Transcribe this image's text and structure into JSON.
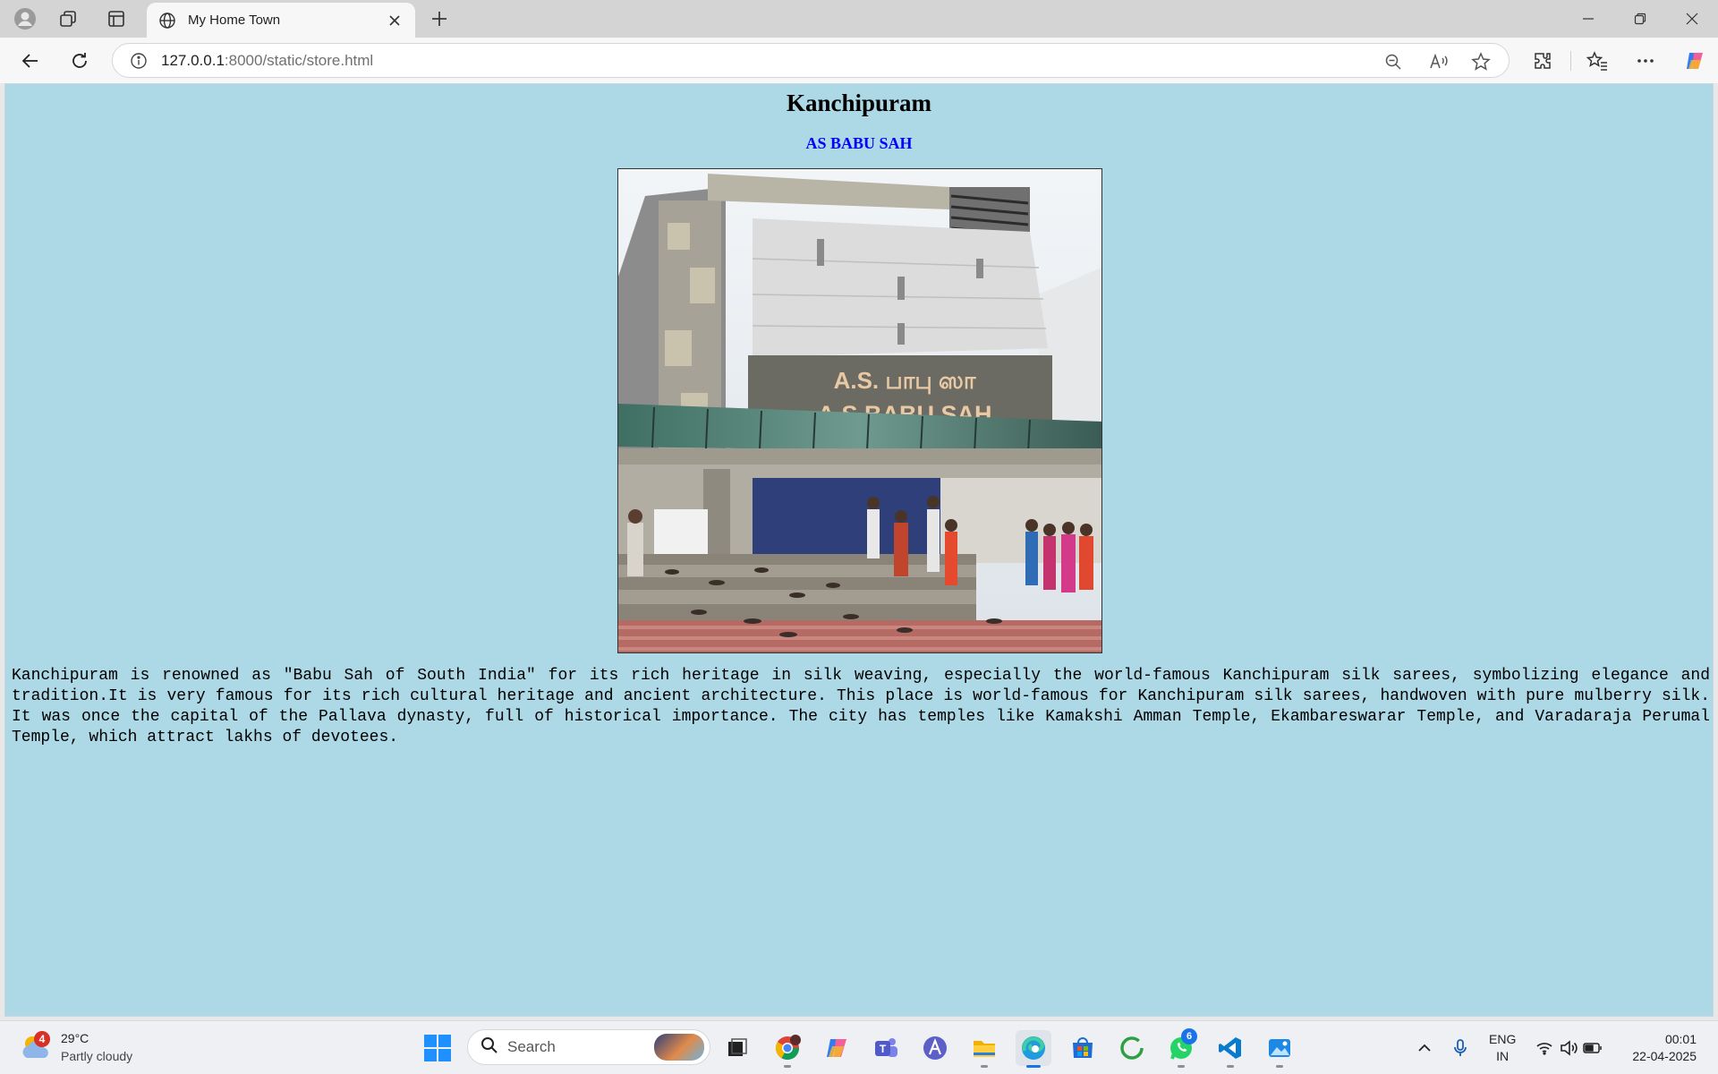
{
  "browser": {
    "tab_title": "My Home Town",
    "url_host": "127.0.0.1",
    "url_path": ":8000/static/store.html"
  },
  "page": {
    "heading": "Kanchipuram",
    "subheading": "AS BABU SAH",
    "photo_alt": "A.S. Babu Sah store building",
    "sign_line_1": "A.S. பாபு ஸா",
    "sign_line_2": "A.S.BABU SAH",
    "paragraph": "Kanchipuram is renowned as \"Babu Sah of South India\" for its rich heritage in silk weaving, especially the world-famous Kanchipuram silk sarees, symbolizing elegance and tradition.It is very famous for its rich cultural heritage and ancient architecture. This place is world-famous for Kanchipuram silk sarees, handwoven with pure mulberry silk. It was once the capital of the Pallava dynasty, full of historical importance. The city has temples like Kamakshi Amman Temple, Ekambareswarar Temple, and Varadaraja Perumal Temple, which attract lakhs of devotees.",
    "colors": {
      "background": "#add8e6",
      "subheading": "#0000ff"
    }
  },
  "taskbar": {
    "weather_badge": "4",
    "temperature": "29°C",
    "condition": "Partly cloudy",
    "search_label": "Search",
    "whatsapp_badge": "6",
    "lang_1": "ENG",
    "lang_2": "IN",
    "time": "00:01",
    "date": "22-04-2025"
  }
}
